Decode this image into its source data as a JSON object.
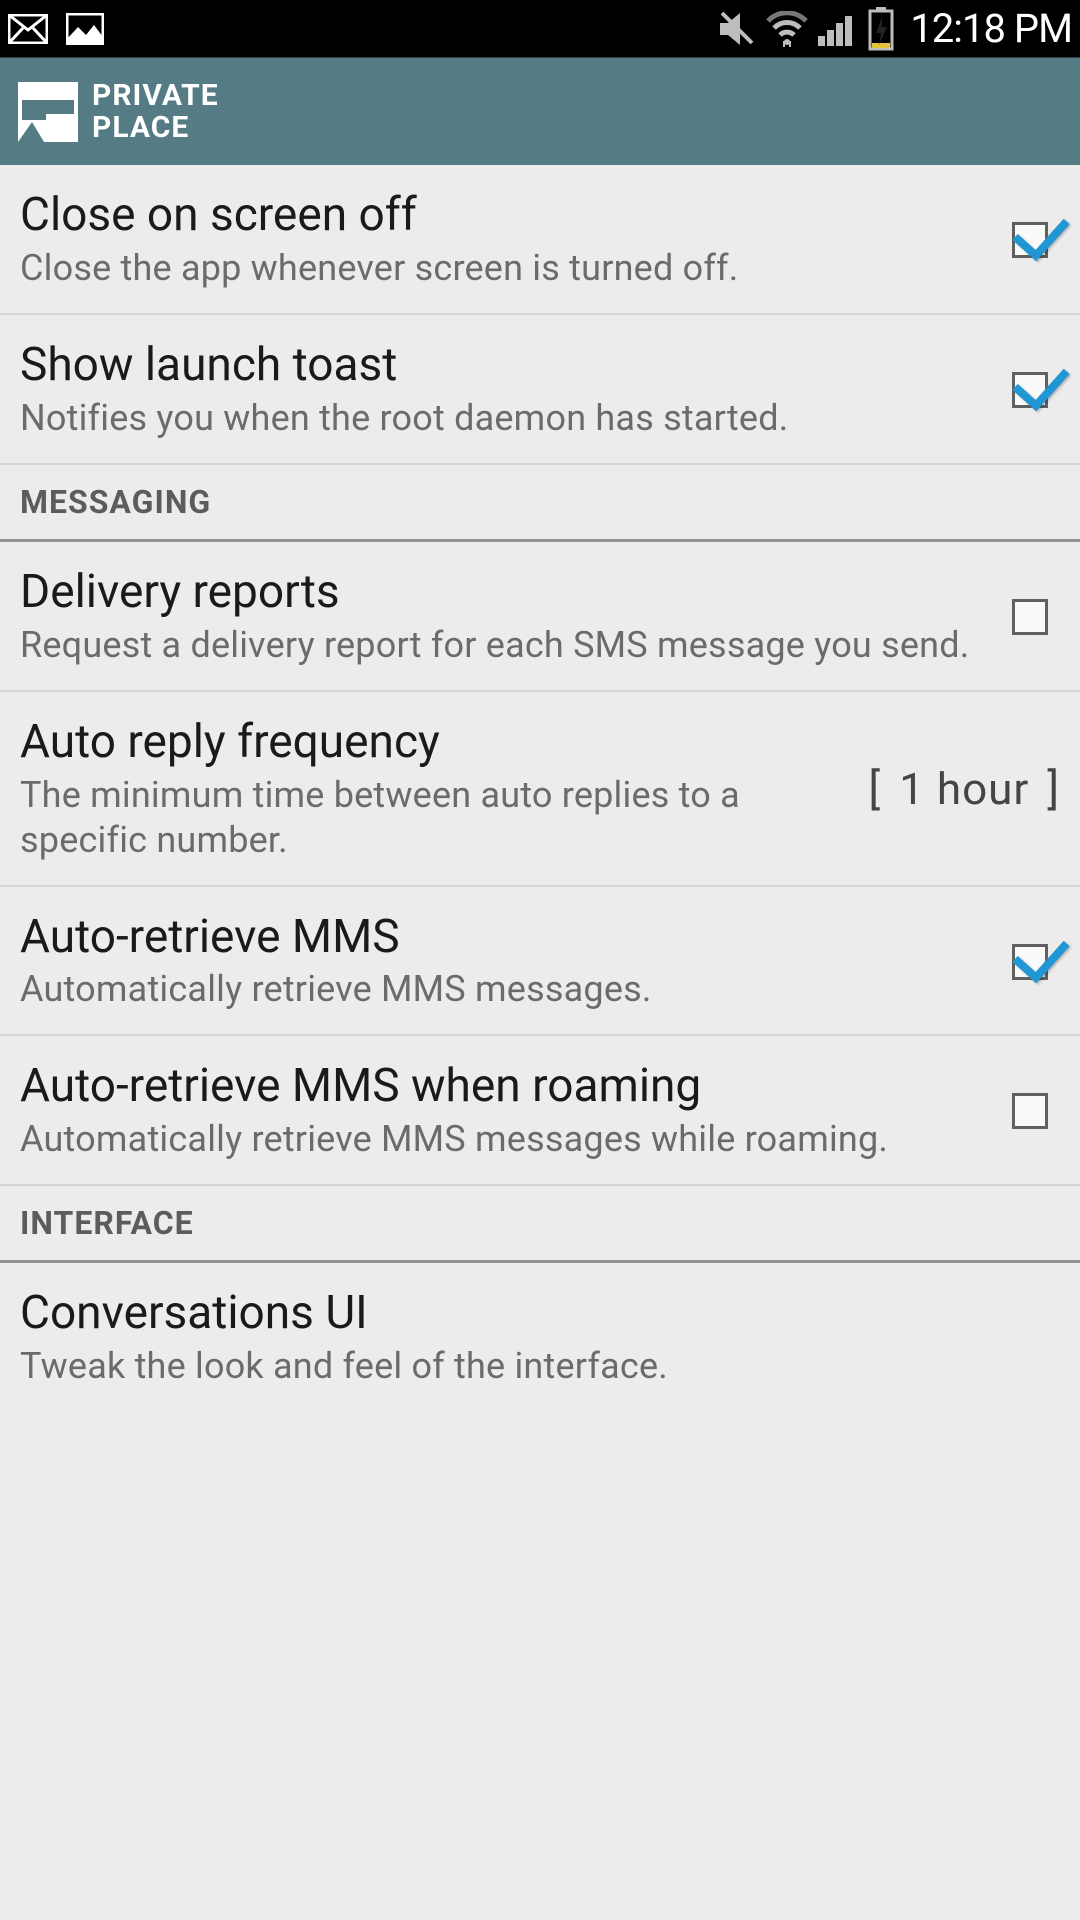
{
  "status_bar": {
    "clock": "12:18 PM"
  },
  "header": {
    "title_line1": "PRIVATE",
    "title_line2": "PLACE"
  },
  "sections": {
    "messaging_label": "MESSAGING",
    "interface_label": "INTERFACE"
  },
  "settings": {
    "close_on_screen_off": {
      "title": "Close on screen off",
      "desc": "Close the app whenever screen is turned off.",
      "checked": true
    },
    "show_launch_toast": {
      "title": "Show launch toast",
      "desc": "Notifies you when the root daemon has started.",
      "checked": true
    },
    "delivery_reports": {
      "title": "Delivery reports",
      "desc": "Request a delivery report for each SMS message you send.",
      "checked": false
    },
    "auto_reply_frequency": {
      "title": "Auto reply frequency",
      "desc": "The minimum time between auto replies to a specific number.",
      "value": "1 hour"
    },
    "auto_retrieve_mms": {
      "title": "Auto-retrieve MMS",
      "desc": "Automatically retrieve MMS messages.",
      "checked": true
    },
    "auto_retrieve_mms_roaming": {
      "title": "Auto-retrieve MMS when roaming",
      "desc": "Automatically retrieve MMS messages while roaming.",
      "checked": false
    },
    "conversations_ui": {
      "title": "Conversations UI",
      "desc": "Tweak the look and feel of the interface."
    }
  }
}
